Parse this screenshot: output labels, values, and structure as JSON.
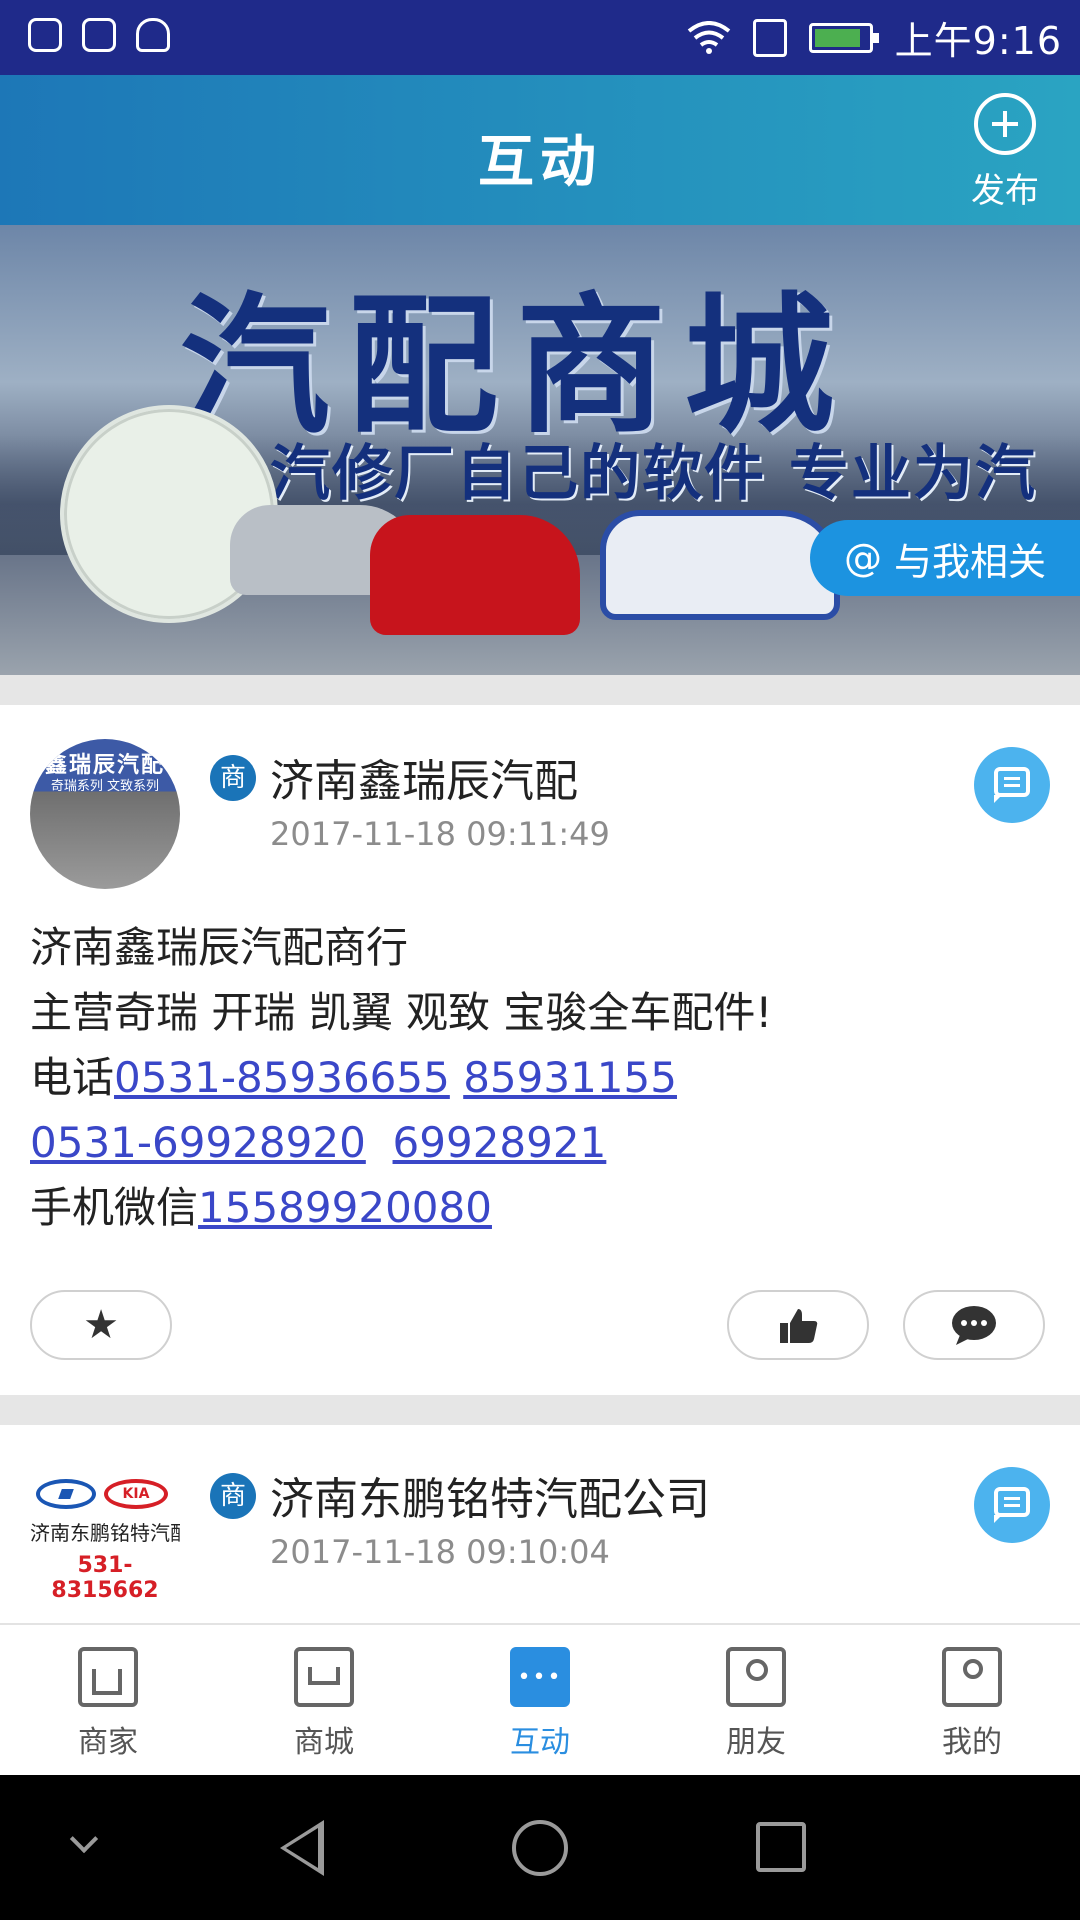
{
  "status_bar": {
    "time": "上午9:16"
  },
  "header": {
    "title": "互动",
    "publish_label": "发布"
  },
  "banner": {
    "title": "汽配商城",
    "subtitle": "汽修厂自己的软件 专业为汽修厂设计",
    "related_label": "与我相关",
    "related_icon": "@"
  },
  "posts": [
    {
      "avatar_text_line1": "鑫瑞辰汽配",
      "avatar_text_line2": "奇瑞系列 文致系列",
      "badge": "商",
      "name": "济南鑫瑞辰汽配",
      "time": "2017-11-18 09:11:49",
      "content": {
        "line1": "济南鑫瑞辰汽配商行",
        "line2": "主营奇瑞 开瑞 凯翼 观致 宝骏全车配件!",
        "phone_prefix": "电话",
        "phone1": "0531-85936655",
        "phone2": "85931155",
        "phone3": "0531-69928920",
        "phone4": "69928921",
        "mobile_prefix": "手机微信",
        "mobile": "15589920080"
      }
    },
    {
      "avatar_kia": "KIA",
      "avatar_text_line1": "济南东鹏铭特汽配",
      "avatar_text_line2": "531-8315662",
      "badge": "商",
      "name": "济南东鹏铭特汽配公司",
      "time": "2017-11-18 09:10:04"
    }
  ],
  "bottom_nav": {
    "items": [
      {
        "label": "商家",
        "icon": "home-icon"
      },
      {
        "label": "商城",
        "icon": "cart-icon"
      },
      {
        "label": "互动",
        "icon": "chat-icon",
        "active": true
      },
      {
        "label": "朋友",
        "icon": "friends-icon"
      },
      {
        "label": "我的",
        "icon": "profile-icon"
      }
    ]
  },
  "colors": {
    "header_start": "#1d77b7",
    "header_end": "#2aa4c2",
    "accent": "#2a8ee0",
    "link": "#3a47c8",
    "badge": "#1a74b8"
  }
}
